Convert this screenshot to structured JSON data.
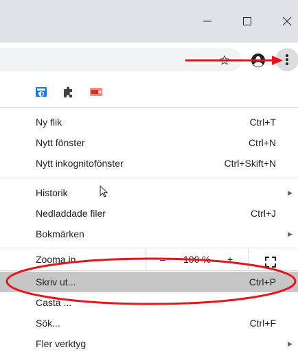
{
  "window_controls": {
    "minimize_icon": "minimize-icon",
    "maximize_icon": "maximize-icon",
    "close_icon": "close-icon"
  },
  "toolbar": {
    "star_icon": "star-icon",
    "profile_icon": "profile-icon",
    "menu_icon": "vertical-dots-icon"
  },
  "extensions": [
    "shield-extension-icon",
    "puzzle-extension-icon",
    "pdf-extension-icon"
  ],
  "menu": {
    "new_tab": {
      "label": "Ny flik",
      "shortcut": "Ctrl+T"
    },
    "new_window": {
      "label": "Nytt fönster",
      "shortcut": "Ctrl+N"
    },
    "new_incognito": {
      "label": "Nytt inkognitofönster",
      "shortcut": "Ctrl+Skift+N"
    },
    "history": {
      "label": "Historik"
    },
    "downloads": {
      "label": "Nedladdade filer",
      "shortcut": "Ctrl+J"
    },
    "bookmarks": {
      "label": "Bokmärken"
    },
    "zoom": {
      "label": "Zooma in",
      "minus": "–",
      "value": "100 %",
      "plus": "+"
    },
    "print": {
      "label": "Skriv ut...",
      "shortcut": "Ctrl+P"
    },
    "cast": {
      "label": "Casta ..."
    },
    "find": {
      "label": "Sök...",
      "shortcut": "Ctrl+F"
    },
    "more_tools": {
      "label": "Fler verktyg"
    }
  },
  "colors": {
    "titlebar": "#dee1e6",
    "highlight": "#c6c6c6",
    "annotation_red": "#e8141c"
  }
}
